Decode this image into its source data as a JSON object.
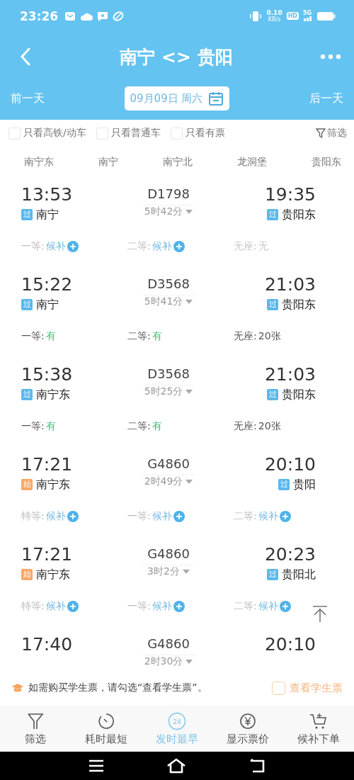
{
  "status_bar": {
    "time": "23:26",
    "speed": "0.10",
    "speed_unit": "KB/s",
    "hd": "HD",
    "network": "5G"
  },
  "header": {
    "title": "南宁 <> 贵阳"
  },
  "date_bar": {
    "prev": "前一天",
    "date": "09月09日 周六",
    "next": "后一天"
  },
  "filters": [
    {
      "label": "只看高铁/动车",
      "checked": false
    },
    {
      "label": "只看普通车",
      "checked": false
    },
    {
      "label": "只看有票",
      "checked": false
    }
  ],
  "filter_button": "筛选",
  "stations": [
    "南宁东",
    "南宁",
    "南宁北",
    "龙洞堡",
    "贵阳东"
  ],
  "trains": [
    {
      "depart": "13:53",
      "from_badge": {
        "kind": "pass",
        "text": "过"
      },
      "from": "南宁",
      "number": "D1798",
      "duration": "5时42分",
      "arrive": "19:35",
      "to_badge": {
        "kind": "pass",
        "text": "过"
      },
      "to": "贵阳东",
      "seats": [
        {
          "class": "一等:",
          "status": "候补",
          "kind": "waitlist"
        },
        {
          "class": "二等:",
          "status": "候补",
          "kind": "waitlist"
        },
        {
          "class": "无座:",
          "status": "无",
          "kind": "none"
        }
      ]
    },
    {
      "depart": "15:22",
      "from_badge": {
        "kind": "pass",
        "text": "过"
      },
      "from": "南宁",
      "number": "D3568",
      "duration": "5时41分",
      "arrive": "21:03",
      "to_badge": {
        "kind": "pass",
        "text": "过"
      },
      "to": "贵阳东",
      "seats": [
        {
          "class": "一等:",
          "status": "有",
          "kind": "available"
        },
        {
          "class": "二等:",
          "status": "有",
          "kind": "available"
        },
        {
          "class": "无座:",
          "status": "20张",
          "kind": "count"
        }
      ]
    },
    {
      "depart": "15:38",
      "from_badge": {
        "kind": "pass",
        "text": "过"
      },
      "from": "南宁东",
      "number": "D3568",
      "duration": "5时25分",
      "arrive": "21:03",
      "to_badge": {
        "kind": "pass",
        "text": "过"
      },
      "to": "贵阳东",
      "seats": [
        {
          "class": "一等:",
          "status": "有",
          "kind": "available"
        },
        {
          "class": "二等:",
          "status": "有",
          "kind": "available"
        },
        {
          "class": "无座:",
          "status": "20张",
          "kind": "count"
        }
      ]
    },
    {
      "depart": "17:21",
      "from_badge": {
        "kind": "start",
        "text": "始"
      },
      "from": "南宁东",
      "number": "G4860",
      "duration": "2时49分",
      "arrive": "20:10",
      "to_badge": {
        "kind": "pass",
        "text": "过"
      },
      "to": "贵阳",
      "seats": [
        {
          "class": "特等:",
          "status": "候补",
          "kind": "waitlist"
        },
        {
          "class": "一等:",
          "status": "候补",
          "kind": "waitlist"
        },
        {
          "class": "二等:",
          "status": "候补",
          "kind": "waitlist"
        }
      ]
    },
    {
      "depart": "17:21",
      "from_badge": {
        "kind": "start",
        "text": "始"
      },
      "from": "南宁东",
      "number": "G4860",
      "duration": "3时2分",
      "arrive": "20:23",
      "to_badge": {
        "kind": "pass",
        "text": "过"
      },
      "to": "贵阳北",
      "seats": [
        {
          "class": "特等:",
          "status": "候补",
          "kind": "waitlist"
        },
        {
          "class": "一等:",
          "status": "候补",
          "kind": "waitlist"
        },
        {
          "class": "二等:",
          "status": "候补",
          "kind": "waitlist"
        }
      ]
    },
    {
      "depart": "17:40",
      "number": "G4860",
      "duration": "2时30分",
      "arrive": "20:10"
    }
  ],
  "student_notice": {
    "text": "如需购买学生票，请勾选“查看学生票”。",
    "option": "查看学生票",
    "checked": false
  },
  "bottom_tabs": [
    {
      "label": "筛选",
      "kind": "filter",
      "selected": false
    },
    {
      "label": "耗时最短",
      "kind": "timer",
      "selected": false
    },
    {
      "label": "发时最早",
      "kind": "clock",
      "badge": "24",
      "selected": true
    },
    {
      "label": "显示票价",
      "kind": "price",
      "selected": false
    },
    {
      "label": "候补下单",
      "kind": "cart",
      "selected": false
    }
  ]
}
